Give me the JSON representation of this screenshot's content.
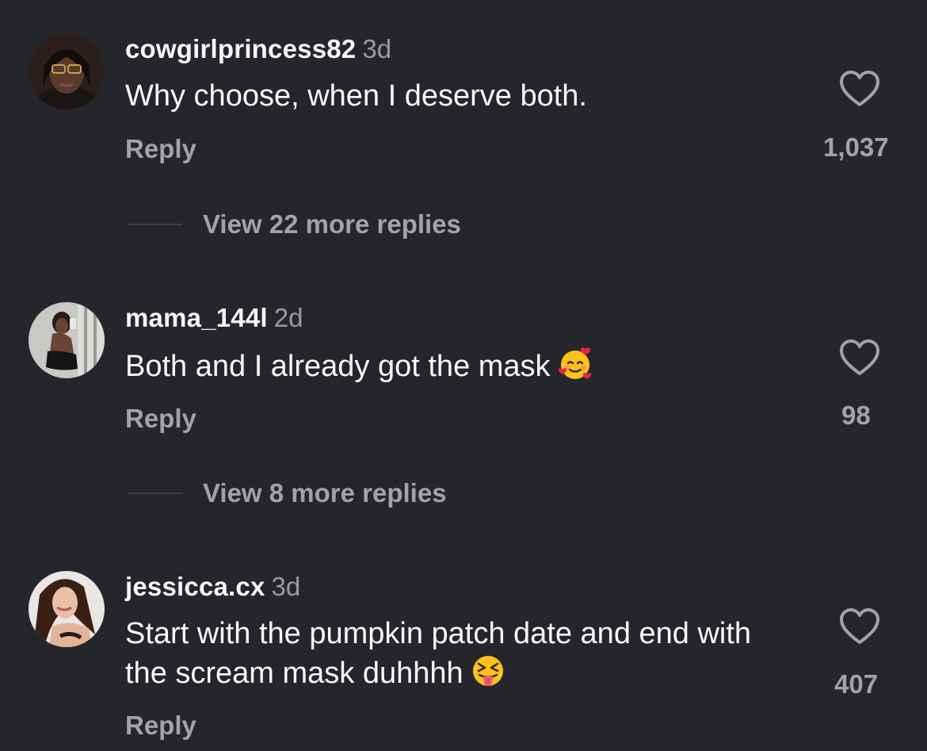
{
  "comments": [
    {
      "username": "cowgirlprincess82",
      "time": "3d",
      "text": "Why choose, when I deserve both.",
      "emoji": "",
      "reply_label": "Reply",
      "likes": "1,037",
      "view_replies": "View 22 more replies"
    },
    {
      "username": "mama_144l",
      "time": "2d",
      "text": "Both and I already got the mask",
      "emoji": "smiling-face-with-hearts",
      "reply_label": "Reply",
      "likes": "98",
      "view_replies": "View 8 more replies"
    },
    {
      "username": "jessicca.cx",
      "time": "3d",
      "text": "Start with the pumpkin patch date and end with the scream mask duhhhh",
      "emoji": "squinting-face-with-tongue",
      "reply_label": "Reply",
      "likes": "407"
    }
  ],
  "icons": {
    "like": "heart-outline-icon"
  },
  "colors": {
    "background": "#25262b",
    "primary_text": "#f5f5f5",
    "secondary_text": "#a2a3a9"
  }
}
